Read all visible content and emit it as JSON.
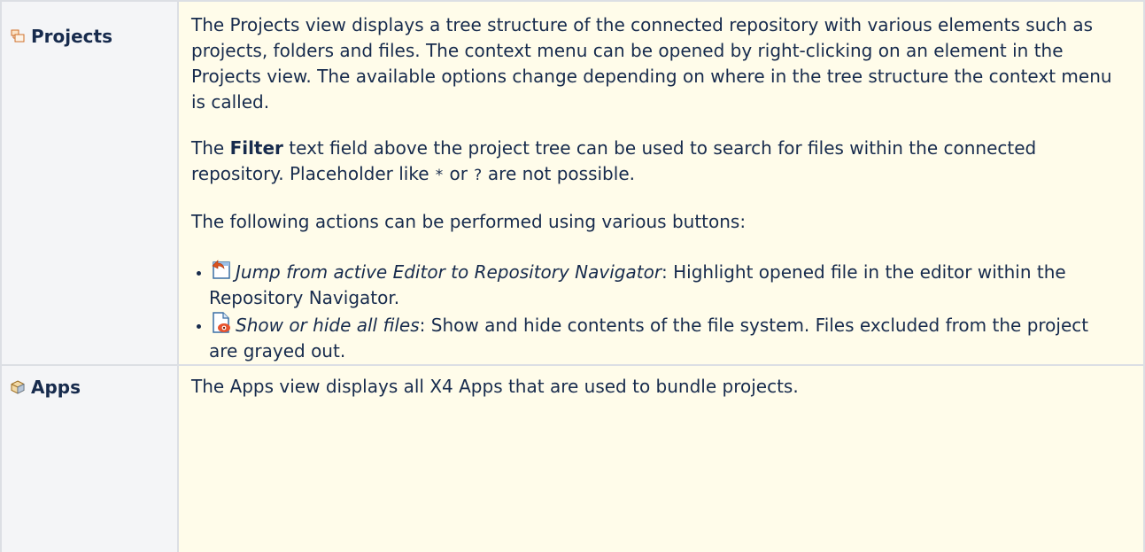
{
  "rows": {
    "projects": {
      "label": "Projects",
      "icon": "projects-view-icon",
      "paragraph1": "The Projects view displays a tree structure of the connected repository with various elements such as projects, folders and files. The context menu can be opened by right-clicking on an element in the Projects view. The available options change depending on where in the tree structure the context menu is called.",
      "filter_pre": "The ",
      "filter_bold": "Filter",
      "filter_mid": " text field above the project tree can be used to search for files within the connected repository. Placeholder like ",
      "placeholder1": "*",
      "filter_or": " or ",
      "placeholder2": "?",
      "filter_post": " are not possible.",
      "actions_intro": "The following actions can be performed using various buttons:",
      "actions": [
        {
          "icon": "jump-to-navigator-icon",
          "name": "Jump from active Editor to Repository Navigator",
          "description": ": Highlight opened file in the editor within the Repository Navigator."
        },
        {
          "icon": "show-hide-files-icon",
          "name": "Show or hide all files",
          "description": ": Show and hide contents of the file system. Files excluded from the project are grayed out."
        }
      ]
    },
    "apps": {
      "label": "Apps",
      "icon": "apps-view-icon",
      "text": "The Apps view displays all X4 Apps that are used to bundle projects."
    }
  },
  "colors": {
    "label_bg": "#f4f5f7",
    "content_bg": "#fffcea",
    "border": "#dcdfe4",
    "text": "#172b4d"
  }
}
